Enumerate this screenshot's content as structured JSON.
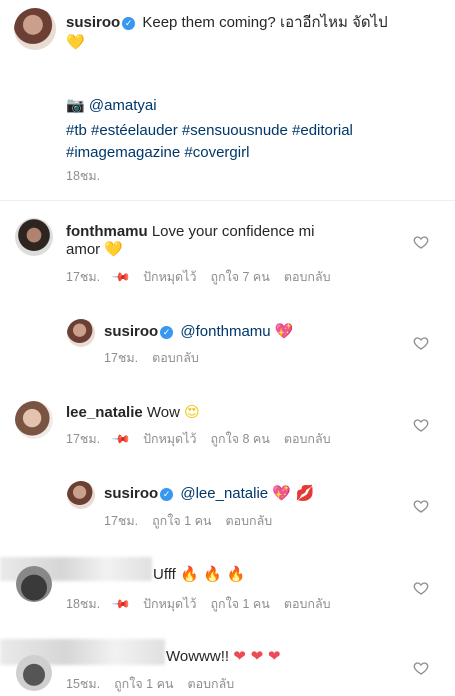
{
  "post": {
    "username": "susiroo",
    "caption": "Keep them coming? เอาอีกไหม จัดไป",
    "caption_emoji": "💛",
    "camera_emoji": "📷",
    "credit": "@amatyai",
    "tags_line1": "#tb #estéelauder #sensuousnude #editorial",
    "tags_line2": "#imagemagazine #covergirl",
    "time": "18ชม."
  },
  "comments": [
    {
      "username": "fonthmamu",
      "text1": "Love your confidence mi",
      "text2": "amor",
      "emoji": "💛",
      "time": "17ชม.",
      "pinned": "ปักหมุดไว้",
      "likes": "ถูกใจ 7 คน",
      "reply": "ตอบกลับ"
    },
    {
      "username": "susiroo",
      "mention": "@fonthmamu",
      "emoji": "💖",
      "time": "17ชม.",
      "reply": "ตอบกลับ"
    },
    {
      "username": "lee_natalie",
      "text": "Wow",
      "emoji": "😍",
      "time": "17ชม.",
      "pinned": "ปักหมุดไว้",
      "likes": "ถูกใจ 8 คน",
      "reply": "ตอบกลับ"
    },
    {
      "username": "susiroo",
      "mention": "@lee_natalie",
      "emoji": "💖 💋",
      "time": "17ชม.",
      "likes": "ถูกใจ 1 คน",
      "reply": "ตอบกลับ"
    },
    {
      "text": "Ufff",
      "emoji": "🔥 🔥 🔥",
      "time": "18ชม.",
      "pinned": "ปักหมุดไว้",
      "likes": "ถูกใจ 1 คน",
      "reply": "ตอบกลับ"
    },
    {
      "text": "Wowww!!",
      "emoji": "❤ ❤ ❤",
      "time": "15ชม.",
      "likes": "ถูกใจ 1 คน",
      "reply": "ตอบกลับ"
    }
  ],
  "colors": {
    "accent_link": "#00376b",
    "meta_gray": "#8e8e8e",
    "verified_blue": "#3897f0"
  }
}
